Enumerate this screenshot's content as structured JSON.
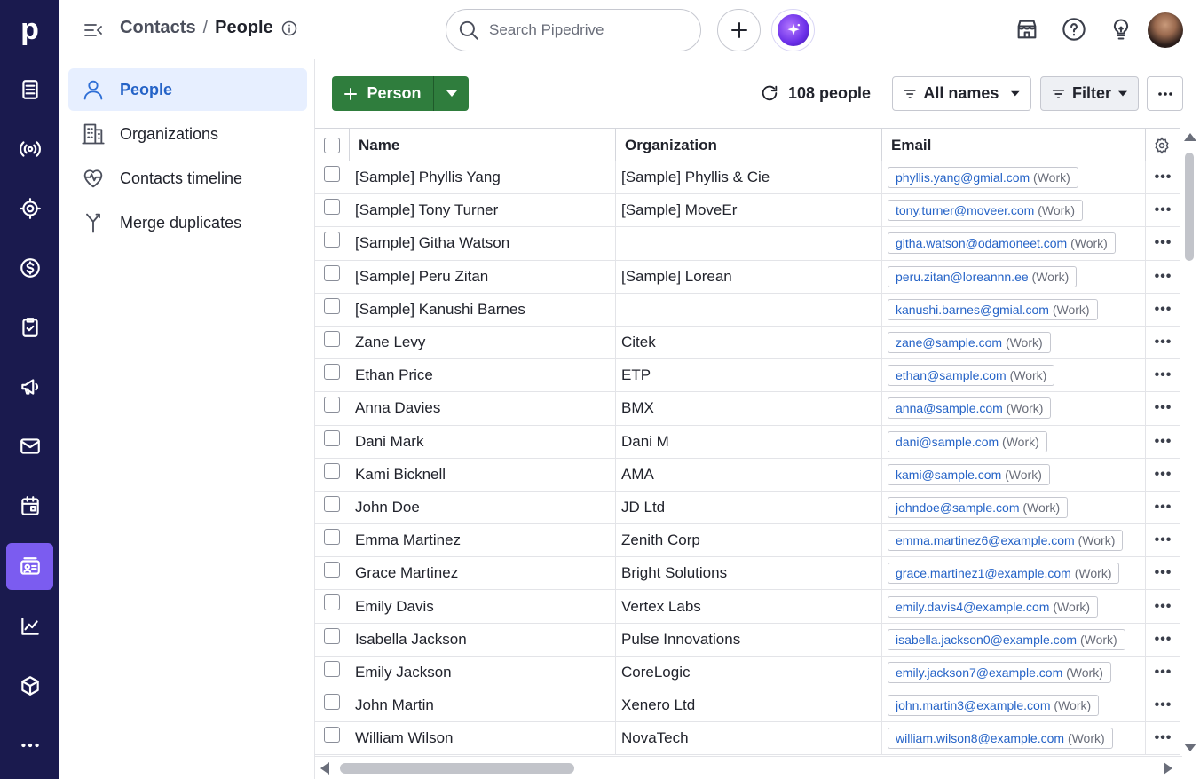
{
  "app": {
    "logo_letter": "p",
    "rail_items": [
      {
        "name": "leads-icon"
      },
      {
        "name": "campaigns-broadcast-icon"
      },
      {
        "name": "target-icon"
      },
      {
        "name": "deals-dollar-icon"
      },
      {
        "name": "activities-clipboard-icon"
      },
      {
        "name": "megaphone-icon"
      },
      {
        "name": "mail-icon"
      },
      {
        "name": "calendar-icon"
      },
      {
        "name": "contacts-card-icon",
        "active": true
      },
      {
        "name": "insights-chart-icon"
      },
      {
        "name": "products-box-icon"
      },
      {
        "name": "more-icon"
      }
    ]
  },
  "header": {
    "breadcrumb_parent": "Contacts",
    "breadcrumb_sep": "/",
    "breadcrumb_current": "People",
    "search_placeholder": "Search Pipedrive"
  },
  "sidebar": {
    "items": [
      {
        "label": "People",
        "icon": "person-icon",
        "active": true
      },
      {
        "label": "Organizations",
        "icon": "building-icon"
      },
      {
        "label": "Contacts timeline",
        "icon": "heart-pulse-icon"
      },
      {
        "label": "Merge duplicates",
        "icon": "merge-icon"
      }
    ]
  },
  "toolbar": {
    "add_label": "Person",
    "count_label": "108 people",
    "names_filter": "All names",
    "filter_label": "Filter"
  },
  "table": {
    "columns": {
      "name": "Name",
      "organization": "Organization",
      "email": "Email"
    },
    "rows": [
      {
        "name": "[Sample] Phyllis Yang",
        "org": "[Sample] Phyllis & Cie",
        "email": "phyllis.yang@gmial.com",
        "tag": "(Work)"
      },
      {
        "name": "[Sample] Tony Turner",
        "org": "[Sample] MoveEr",
        "email": "tony.turner@moveer.com",
        "tag": "(Work)"
      },
      {
        "name": "[Sample] Githa Watson",
        "org": "",
        "email": "githa.watson@odamoneet.com",
        "tag": "(Work)"
      },
      {
        "name": "[Sample] Peru Zitan",
        "org": "[Sample] Lorean",
        "email": "peru.zitan@loreannn.ee",
        "tag": "(Work)"
      },
      {
        "name": "[Sample] Kanushi Barnes",
        "org": "",
        "email": "kanushi.barnes@gmial.com",
        "tag": "(Work)"
      },
      {
        "name": "Zane Levy",
        "org": "Citek",
        "email": "zane@sample.com",
        "tag": "(Work)"
      },
      {
        "name": "Ethan Price",
        "org": "ETP",
        "email": "ethan@sample.com",
        "tag": "(Work)"
      },
      {
        "name": "Anna Davies",
        "org": "BMX",
        "email": "anna@sample.com",
        "tag": "(Work)"
      },
      {
        "name": "Dani Mark",
        "org": "Dani M",
        "email": "dani@sample.com",
        "tag": "(Work)"
      },
      {
        "name": "Kami Bicknell",
        "org": "AMA",
        "email": "kami@sample.com",
        "tag": "(Work)"
      },
      {
        "name": "John Doe",
        "org": "JD Ltd",
        "email": "johndoe@sample.com",
        "tag": "(Work)"
      },
      {
        "name": "Emma Martinez",
        "org": "Zenith Corp",
        "email": "emma.martinez6@example.com",
        "tag": "(Work)"
      },
      {
        "name": "Grace Martinez",
        "org": "Bright Solutions",
        "email": "grace.martinez1@example.com",
        "tag": "(Work)"
      },
      {
        "name": "Emily Davis",
        "org": "Vertex Labs",
        "email": "emily.davis4@example.com",
        "tag": "(Work)"
      },
      {
        "name": "Isabella Jackson",
        "org": "Pulse Innovations",
        "email": "isabella.jackson0@example.com",
        "tag": "(Work)"
      },
      {
        "name": "Emily Jackson",
        "org": "CoreLogic",
        "email": "emily.jackson7@example.com",
        "tag": "(Work)"
      },
      {
        "name": "John Martin",
        "org": "Xenero Ltd",
        "email": "john.martin3@example.com",
        "tag": "(Work)"
      },
      {
        "name": "William Wilson",
        "org": "NovaTech",
        "email": "william.wilson8@example.com",
        "tag": "(Work)"
      }
    ]
  },
  "colors": {
    "rail": "#1a1a4e",
    "rail_active": "#7b5cf0",
    "primary_green": "#2f7d3d",
    "link_blue": "#2563c7",
    "sidebar_active_bg": "#e7efff"
  }
}
